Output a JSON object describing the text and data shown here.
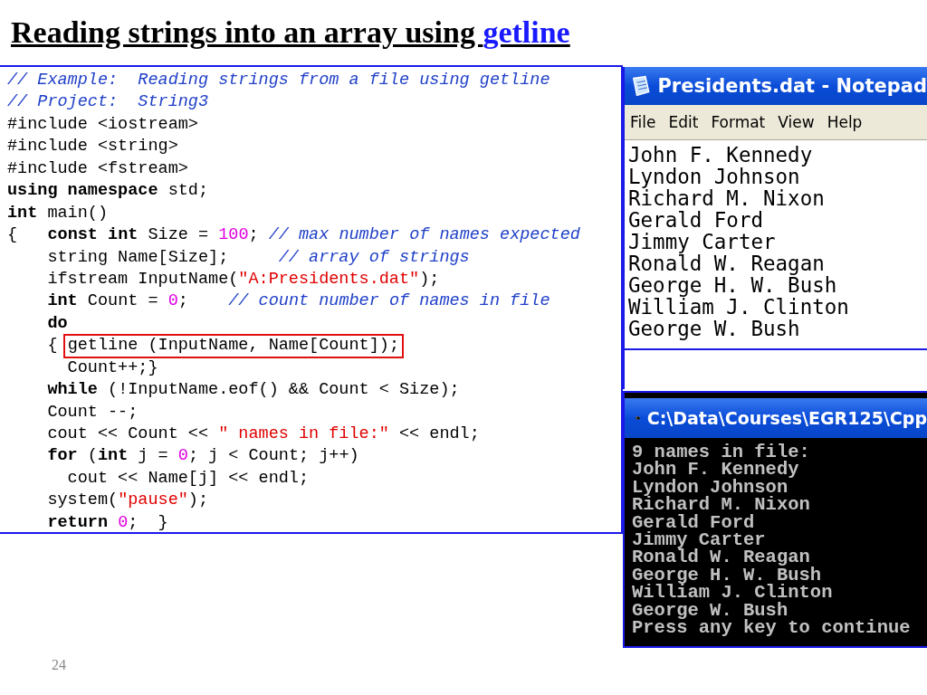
{
  "slide_title": {
    "text": "Reading strings into an array using ",
    "highlight": "getline"
  },
  "code_editor": {
    "lines": [
      [
        {
          "kind": "comment",
          "text": "// Example:  Reading strings from a file using getline"
        }
      ],
      [
        {
          "kind": "comment",
          "text": "// Project:  String3"
        }
      ],
      [
        {
          "kind": "plain",
          "text": "#include <iostream>"
        }
      ],
      [
        {
          "kind": "plain",
          "text": "#include <string>"
        }
      ],
      [
        {
          "kind": "plain",
          "text": "#include <fstream>"
        }
      ],
      [
        {
          "kind": "keyword",
          "text": "using namespace"
        },
        {
          "kind": "plain",
          "text": " std;"
        }
      ],
      [
        {
          "kind": "keyword",
          "text": "int"
        },
        {
          "kind": "plain",
          "text": " main()"
        }
      ],
      [
        {
          "kind": "plain",
          "text": "{   "
        },
        {
          "kind": "keyword",
          "text": "const int"
        },
        {
          "kind": "plain",
          "text": " Size = "
        },
        {
          "kind": "number",
          "text": "100"
        },
        {
          "kind": "plain",
          "text": "; "
        },
        {
          "kind": "comment",
          "text": "// max number of names expected"
        }
      ],
      [
        {
          "kind": "plain",
          "text": "    string Name[Size];     "
        },
        {
          "kind": "comment",
          "text": "// array of strings"
        }
      ],
      [
        {
          "kind": "plain",
          "text": "    ifstream InputName("
        },
        {
          "kind": "string",
          "text": "\"A:Presidents.dat\""
        },
        {
          "kind": "plain",
          "text": ");"
        }
      ],
      [
        {
          "kind": "keyword",
          "text": "    int"
        },
        {
          "kind": "plain",
          "text": " Count = "
        },
        {
          "kind": "number",
          "text": "0"
        },
        {
          "kind": "plain",
          "text": ";    "
        },
        {
          "kind": "comment",
          "text": "// count number of names in file"
        }
      ],
      [
        {
          "kind": "keyword",
          "text": "    do"
        }
      ],
      [
        {
          "kind": "plain",
          "text": "    { "
        },
        {
          "kind": "boxed",
          "text": "getline (InputName, Name[Count]);"
        }
      ],
      [
        {
          "kind": "plain",
          "text": "      Count++;}"
        }
      ],
      [
        {
          "kind": "keyword",
          "text": "    while"
        },
        {
          "kind": "plain",
          "text": " (!InputName.eof() && Count < Size);"
        }
      ],
      [
        {
          "kind": "plain",
          "text": "    Count --;"
        }
      ],
      [
        {
          "kind": "plain",
          "text": "    cout << Count << "
        },
        {
          "kind": "string",
          "text": "\" names in file:\""
        },
        {
          "kind": "plain",
          "text": " << endl;"
        }
      ],
      [
        {
          "kind": "keyword",
          "text": "    for"
        },
        {
          "kind": "plain",
          "text": " ("
        },
        {
          "kind": "keyword",
          "text": "int"
        },
        {
          "kind": "plain",
          "text": " j = "
        },
        {
          "kind": "number",
          "text": "0"
        },
        {
          "kind": "plain",
          "text": "; j < Count; j++)"
        }
      ],
      [
        {
          "kind": "plain",
          "text": "      cout << Name[j] << endl;"
        }
      ],
      [
        {
          "kind": "plain",
          "text": "    system("
        },
        {
          "kind": "string",
          "text": "\"pause\""
        },
        {
          "kind": "plain",
          "text": ");"
        }
      ],
      [
        {
          "kind": "keyword",
          "text": "    return"
        },
        {
          "kind": "number",
          "text": " 0"
        },
        {
          "kind": "plain",
          "text": ";  }"
        }
      ]
    ]
  },
  "notepad": {
    "title": "Presidents.dat - Notepad",
    "menu": [
      "File",
      "Edit",
      "Format",
      "View",
      "Help"
    ],
    "lines": [
      "John F. Kennedy",
      "Lyndon Johnson",
      "Richard M. Nixon",
      "Gerald Ford",
      "Jimmy Carter",
      "Ronald W. Reagan",
      "George H. W. Bush",
      "William J. Clinton",
      "George W. Bush"
    ]
  },
  "console": {
    "title": "C:\\Data\\Courses\\EGR125\\Cpp",
    "lines": [
      "9 names in file:",
      "John F. Kennedy",
      "Lyndon Johnson",
      "Richard M. Nixon",
      "Gerald Ford",
      "Jimmy Carter",
      "Ronald W. Reagan",
      "George H. W. Bush",
      "William J. Clinton",
      "George W. Bush",
      "Press any key to continue"
    ]
  },
  "page_number": "24"
}
